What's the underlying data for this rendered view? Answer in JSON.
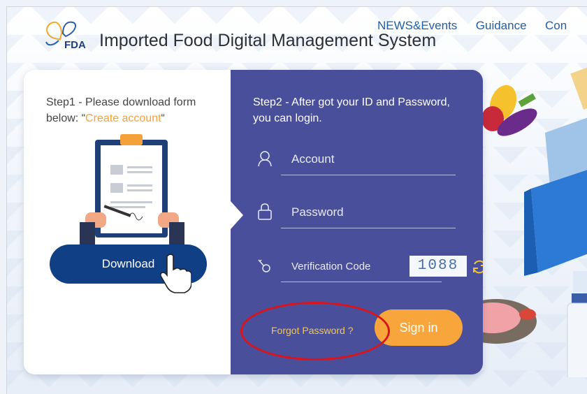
{
  "header": {
    "title": "Imported Food Digital Management System",
    "logo_text": "FDA",
    "nav": [
      "NEWS&Events",
      "Guidance",
      "Con"
    ]
  },
  "step1": {
    "text": "Step1 - Please download form below: “",
    "link": "Create account",
    "tail": "“",
    "download_label": "Download"
  },
  "step2": {
    "text": "Step2 - After got your ID and Password, you can login.",
    "account_placeholder": "Account",
    "password_placeholder": "Password",
    "verification_placeholder": "Verification Code",
    "captcha": "1088",
    "forgot_label": "Forgot Password ?",
    "signin_label": "Sign in"
  },
  "colors": {
    "panel_bg": "#4a4f9b",
    "download_bg": "#103f86",
    "signin_bg": "#f8a53c",
    "link_orange": "#f5a13a",
    "forgot_yellow": "#f4c64a",
    "highlight_red": "#d9141c"
  },
  "icons": [
    "fda-butterfly-logo-icon",
    "clipboard-icon",
    "pointer-hand-icon",
    "user-icon",
    "lock-icon",
    "key-icon",
    "refresh-icon"
  ]
}
